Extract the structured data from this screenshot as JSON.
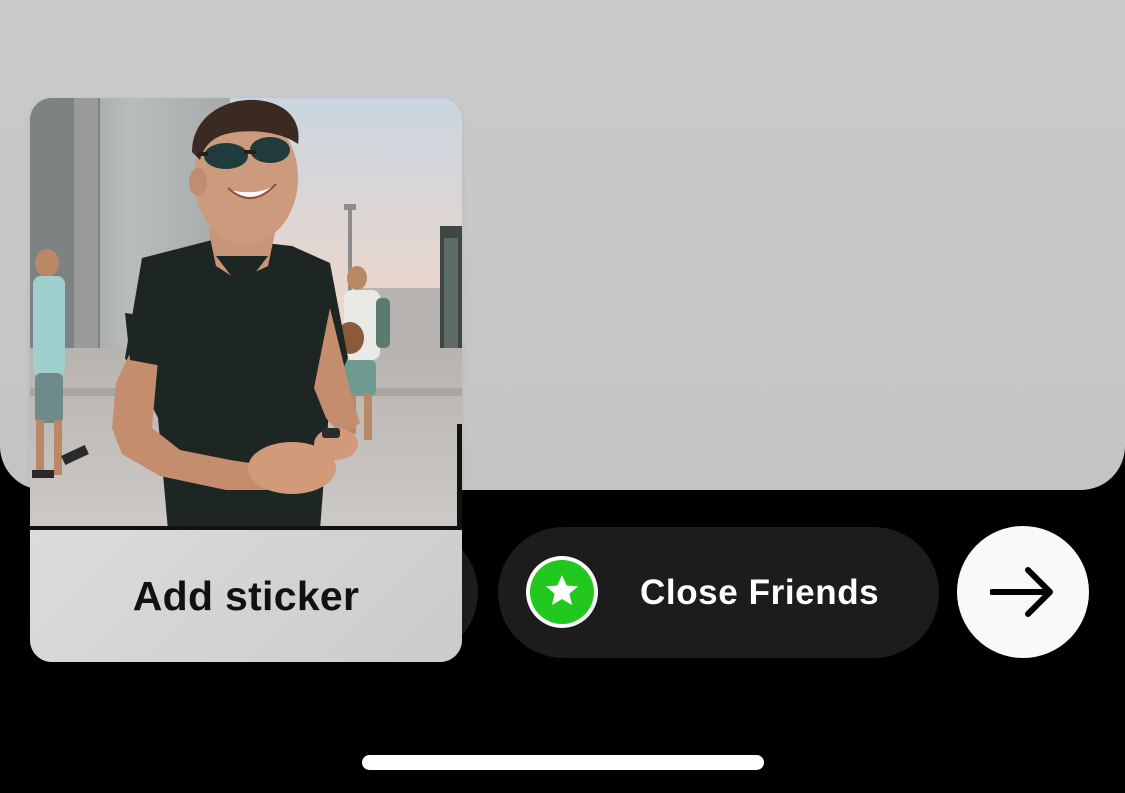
{
  "sticker": {
    "label": "Add sticker"
  },
  "audience": {
    "label": "Close Friends",
    "icon": "star-icon",
    "icon_color": "#22c81d"
  },
  "next": {
    "icon": "arrow-right-icon"
  },
  "colors": {
    "canvas": "#c7c8ca",
    "pill": "#1c1c1c",
    "next_button": "#f9f9f9"
  }
}
